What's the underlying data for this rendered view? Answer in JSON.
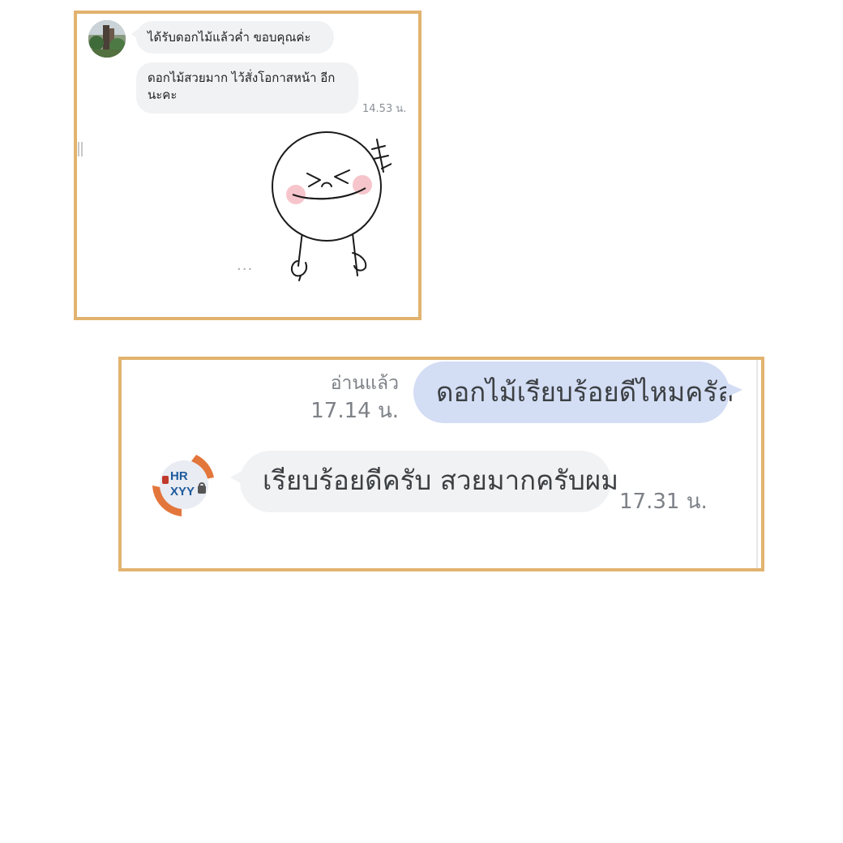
{
  "panel_top": {
    "messages": [
      {
        "text": "ได้รับดอกไม้แล้วค่ำ ขอบคุณค่ะ"
      },
      {
        "text": "ดอกไม้สวยมาก ไว้สั่งโอกาสหน้า อีกนะคะ"
      }
    ],
    "time": "14.53 น.",
    "more": "...",
    "sticker": "laughing-face-sticker"
  },
  "panel_bottom": {
    "read_status": "อ่านแล้ว",
    "sent_time": "17.14 น.",
    "sent_message": "ดอกไม้เรียบร้อยดีไหมครัล",
    "reply_message": "เรียบร้อยดีครับ สวยมากครับผม",
    "reply_time": "17.31 น.",
    "reply_avatar": {
      "line1": "HR",
      "line2": "XYY"
    }
  },
  "colors": {
    "frame": "#e2b36f",
    "bubble_incoming": "#f1f2f4",
    "bubble_outgoing": "#d3ddf4",
    "avatar_orange": "#e3763b",
    "avatar_blue": "#1e5a9c"
  }
}
